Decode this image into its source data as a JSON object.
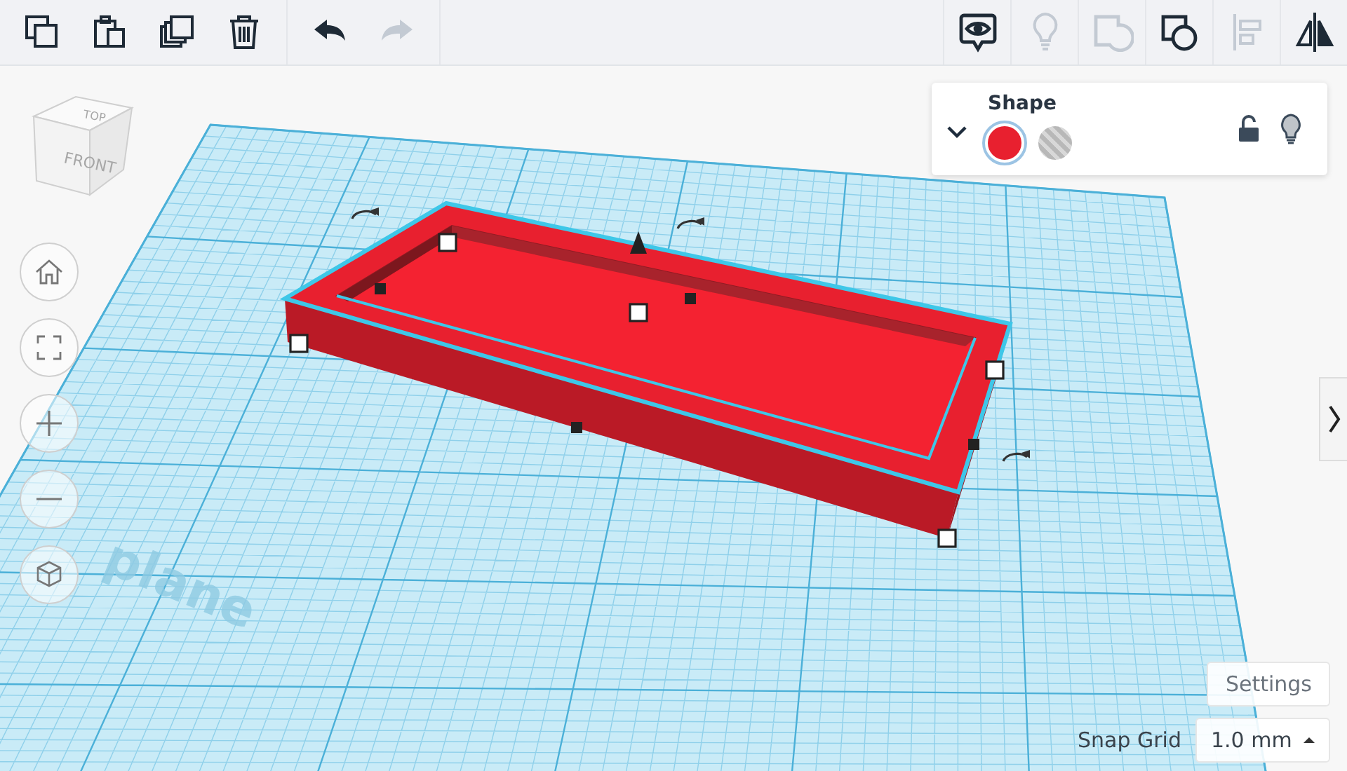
{
  "toolbar": {
    "edit_tools": [
      {
        "kind": "copy",
        "disabled": false
      },
      {
        "kind": "paste",
        "disabled": false
      },
      {
        "kind": "duplicate",
        "disabled": false
      },
      {
        "kind": "delete",
        "disabled": false
      }
    ],
    "history": [
      {
        "kind": "undo",
        "disabled": false
      },
      {
        "kind": "redo",
        "disabled": true
      }
    ],
    "shape_tools": [
      {
        "kind": "notes",
        "disabled": false
      },
      {
        "kind": "visibility",
        "disabled": true
      },
      {
        "kind": "ungroup",
        "disabled": true
      },
      {
        "kind": "group",
        "disabled": false
      },
      {
        "kind": "align",
        "disabled": true
      },
      {
        "kind": "mirror",
        "disabled": false
      }
    ]
  },
  "view_cube": {
    "top": "TOP",
    "front": "FRONT"
  },
  "view_controls": [
    {
      "kind": "home"
    },
    {
      "kind": "fit"
    },
    {
      "kind": "zoom_in"
    },
    {
      "kind": "zoom_out"
    },
    {
      "kind": "perspective"
    }
  ],
  "workplane": {
    "label": "plane"
  },
  "shape_panel": {
    "title": "Shape",
    "expanded": true,
    "locked": false,
    "options": [
      {
        "kind": "solid",
        "selected": true,
        "color": "#e8202f"
      },
      {
        "kind": "hole",
        "selected": false
      }
    ]
  },
  "settings_button": "Settings",
  "snap_grid": {
    "label": "Snap Grid",
    "value": "1.0 mm"
  }
}
